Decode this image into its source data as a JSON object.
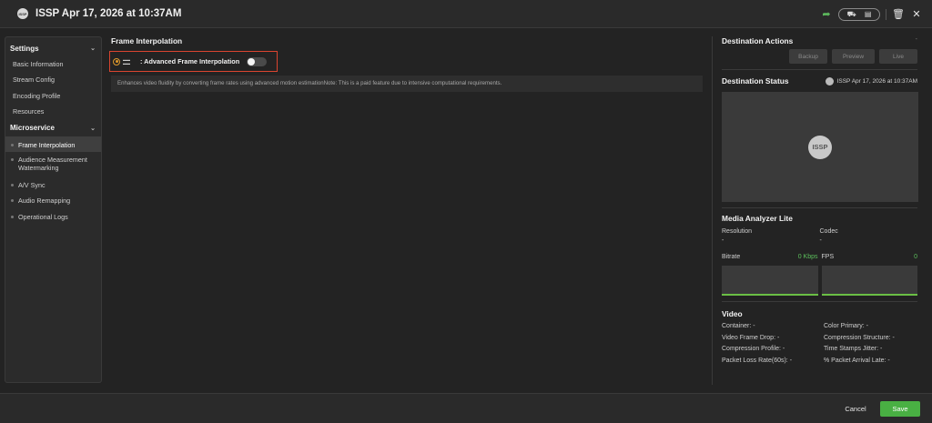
{
  "window": {
    "title": "ISSP Apr 17, 2026 at 10:37AM",
    "badge": "ISSP"
  },
  "top_actions": {
    "share_icon": "share-icon",
    "icons": [
      "diagram-icon",
      "panel-icon",
      "trash-icon",
      "close-icon"
    ]
  },
  "sidebar": {
    "settings_label": "Settings",
    "settings_items": [
      "Basic Information",
      "Stream Config",
      "Encoding Profile",
      "Resources"
    ],
    "microservice_label": "Microservice",
    "microservice_items": [
      "Frame Interpolation",
      "Audience Measurement Watermarking",
      "A/V Sync",
      "Audio Remapping",
      "Operational Logs"
    ],
    "active_item": "Frame Interpolation"
  },
  "main": {
    "title": "Frame Interpolation",
    "feature_label": ": Advanced Frame Interpolation",
    "toggle_on": false,
    "description": "Enhances video fluidity by converting frame rates using advanced motion estimationNote: This is a paid feature due to intensive computational requirements."
  },
  "destination": {
    "actions_title": "Destination Actions",
    "dash": "-",
    "buttons": [
      "Backup",
      "Preview",
      "Live"
    ],
    "status_title": "Destination Status",
    "status_meta": "ISSP Apr 17, 2026 at 10:37AM",
    "preview_logo": "ISSP"
  },
  "analyzer": {
    "title": "Media Analyzer Lite",
    "resolution_label": "Resolution",
    "resolution_value": "-",
    "codec_label": "Codec",
    "codec_value": "-",
    "bitrate_label": "Bitrate",
    "bitrate_value": "0 Kbps",
    "fps_label": "FPS",
    "fps_value": "0"
  },
  "video": {
    "title": "Video",
    "fields": [
      "Container: -",
      "Color Primary: -",
      "Video Frame Drop: -",
      "Compression Structure: -",
      "Compression Profile: -",
      "Time Stamps Jitter: -",
      "Packet Loss Rate(60s): -",
      "% Packet Arrival Late: -"
    ]
  },
  "footer": {
    "cancel_label": "Cancel",
    "save_label": "Save"
  },
  "colors": {
    "accent_green": "#49b043",
    "highlight_red": "#d9442f"
  }
}
